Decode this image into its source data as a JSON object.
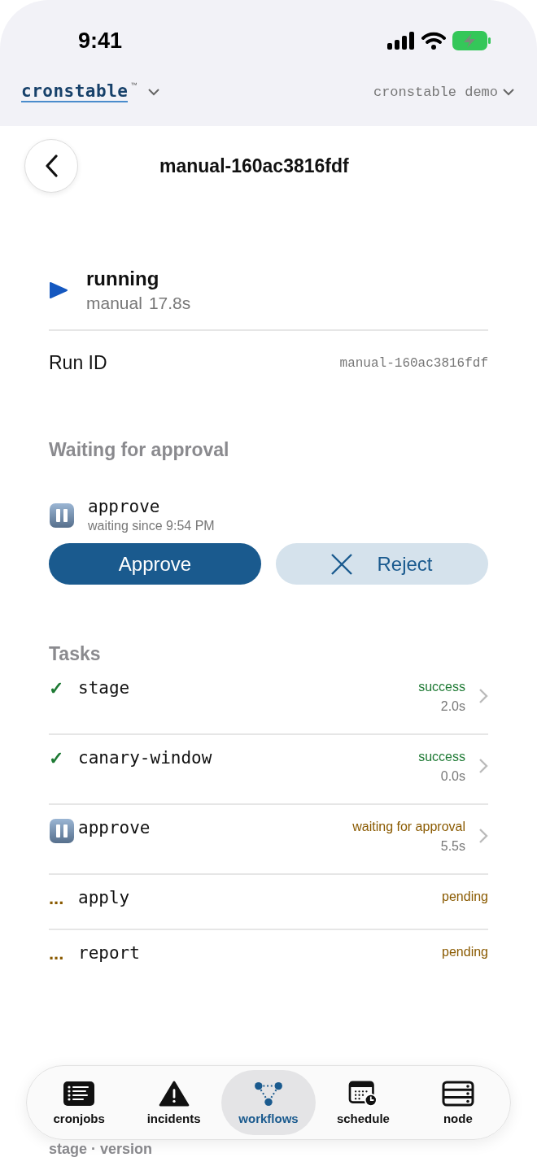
{
  "status_bar": {
    "time": "9:41"
  },
  "header": {
    "brand": "cronstable",
    "trademark": "™",
    "workspace": "cronstable demo"
  },
  "nav": {
    "title": "manual-160ac3816fdf"
  },
  "run": {
    "state": "running",
    "trigger": "manual",
    "duration": "17.8s",
    "run_id_label": "Run ID",
    "run_id": "manual-160ac3816fdf"
  },
  "approval": {
    "heading": "Waiting for approval",
    "task": "approve",
    "since": "waiting since 9:54 PM",
    "approve_label": "Approve",
    "reject_label": "Reject"
  },
  "tasks": {
    "heading": "Tasks",
    "items": [
      {
        "kind": "success",
        "icon": "✓",
        "name": "stage",
        "status": "success",
        "duration": "2.0s"
      },
      {
        "kind": "success",
        "icon": "✓",
        "name": "canary-window",
        "status": "success",
        "duration": "0.0s"
      },
      {
        "kind": "waiting",
        "name": "approve",
        "status": "waiting for approval",
        "duration": "5.5s"
      },
      {
        "kind": "pending",
        "icon": "...",
        "name": "apply",
        "status": "pending"
      },
      {
        "kind": "pending",
        "icon": "...",
        "name": "report",
        "status": "pending"
      }
    ]
  },
  "below": {
    "caption": "stage · version"
  },
  "tab_bar": [
    {
      "label": "cronjobs",
      "selected": false
    },
    {
      "label": "incidents",
      "selected": false
    },
    {
      "label": "workflows",
      "selected": true
    },
    {
      "label": "schedule",
      "selected": false
    },
    {
      "label": "node",
      "selected": false
    }
  ]
}
